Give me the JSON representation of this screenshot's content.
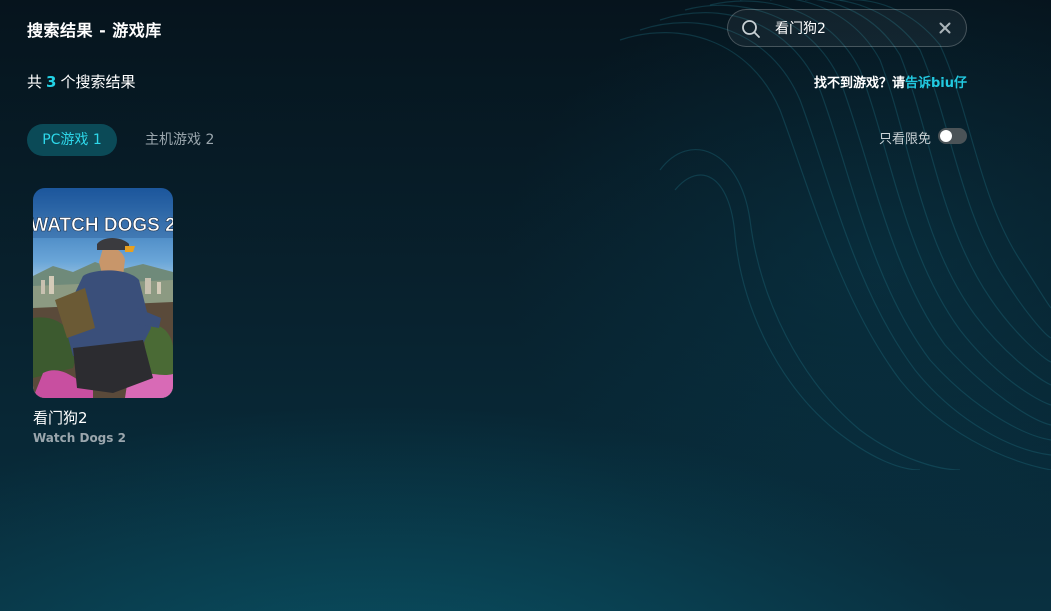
{
  "header": {
    "title": "搜索结果 - 游戏库"
  },
  "search": {
    "value": "看门狗2",
    "icon": "search-icon",
    "clear_icon": "close-icon"
  },
  "results": {
    "prefix": "共",
    "count": "3",
    "suffix": "个搜索结果"
  },
  "help": {
    "text": "找不到游戏？请",
    "link": "告诉biu仔"
  },
  "tabs": [
    {
      "label": "PC游戏 1",
      "active": true
    },
    {
      "label": "主机游戏 2",
      "active": false
    }
  ],
  "filter": {
    "label": "只看限免",
    "enabled": false
  },
  "games": [
    {
      "title": "看门狗2",
      "subtitle": "Watch Dogs 2",
      "cover_text": "WATCH DOGS 2"
    }
  ],
  "colors": {
    "accent": "#22d3e6",
    "active_tab_bg": "#0b4a57",
    "background": "#082330"
  }
}
